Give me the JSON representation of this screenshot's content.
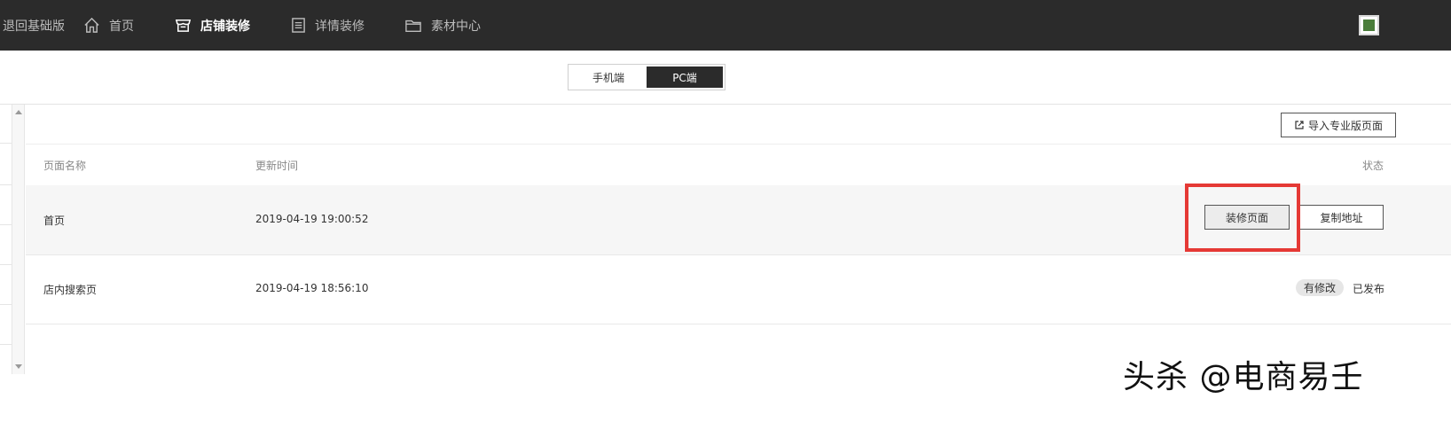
{
  "topbar": {
    "back_label": "退回基础版",
    "nav": [
      {
        "label": "首页",
        "icon": "home-icon"
      },
      {
        "label": "店铺装修",
        "icon": "store-icon"
      },
      {
        "label": "详情装修",
        "icon": "document-icon"
      },
      {
        "label": "素材中心",
        "icon": "folder-icon"
      }
    ],
    "active_index": 1
  },
  "platform_toggle": {
    "options": [
      "手机端",
      "PC端"
    ],
    "selected": "PC端"
  },
  "toolbar": {
    "import_label": "导入专业版页面"
  },
  "table": {
    "columns": [
      "页面名称",
      "更新时间",
      "状态"
    ],
    "rows": [
      {
        "name": "首页",
        "updated": "2019-04-19 19:00:52",
        "actions": [
          "装修页面",
          "复制地址"
        ]
      },
      {
        "name": "店内搜索页",
        "updated": "2019-04-19 18:56:10",
        "badge": "有修改",
        "status": "已发布"
      }
    ]
  },
  "watermark": "头杀 @电商易壬",
  "colors": {
    "topbar_bg": "#2b2b2b",
    "highlight": "#e53935",
    "toggle_active": "#2b2b2b"
  }
}
